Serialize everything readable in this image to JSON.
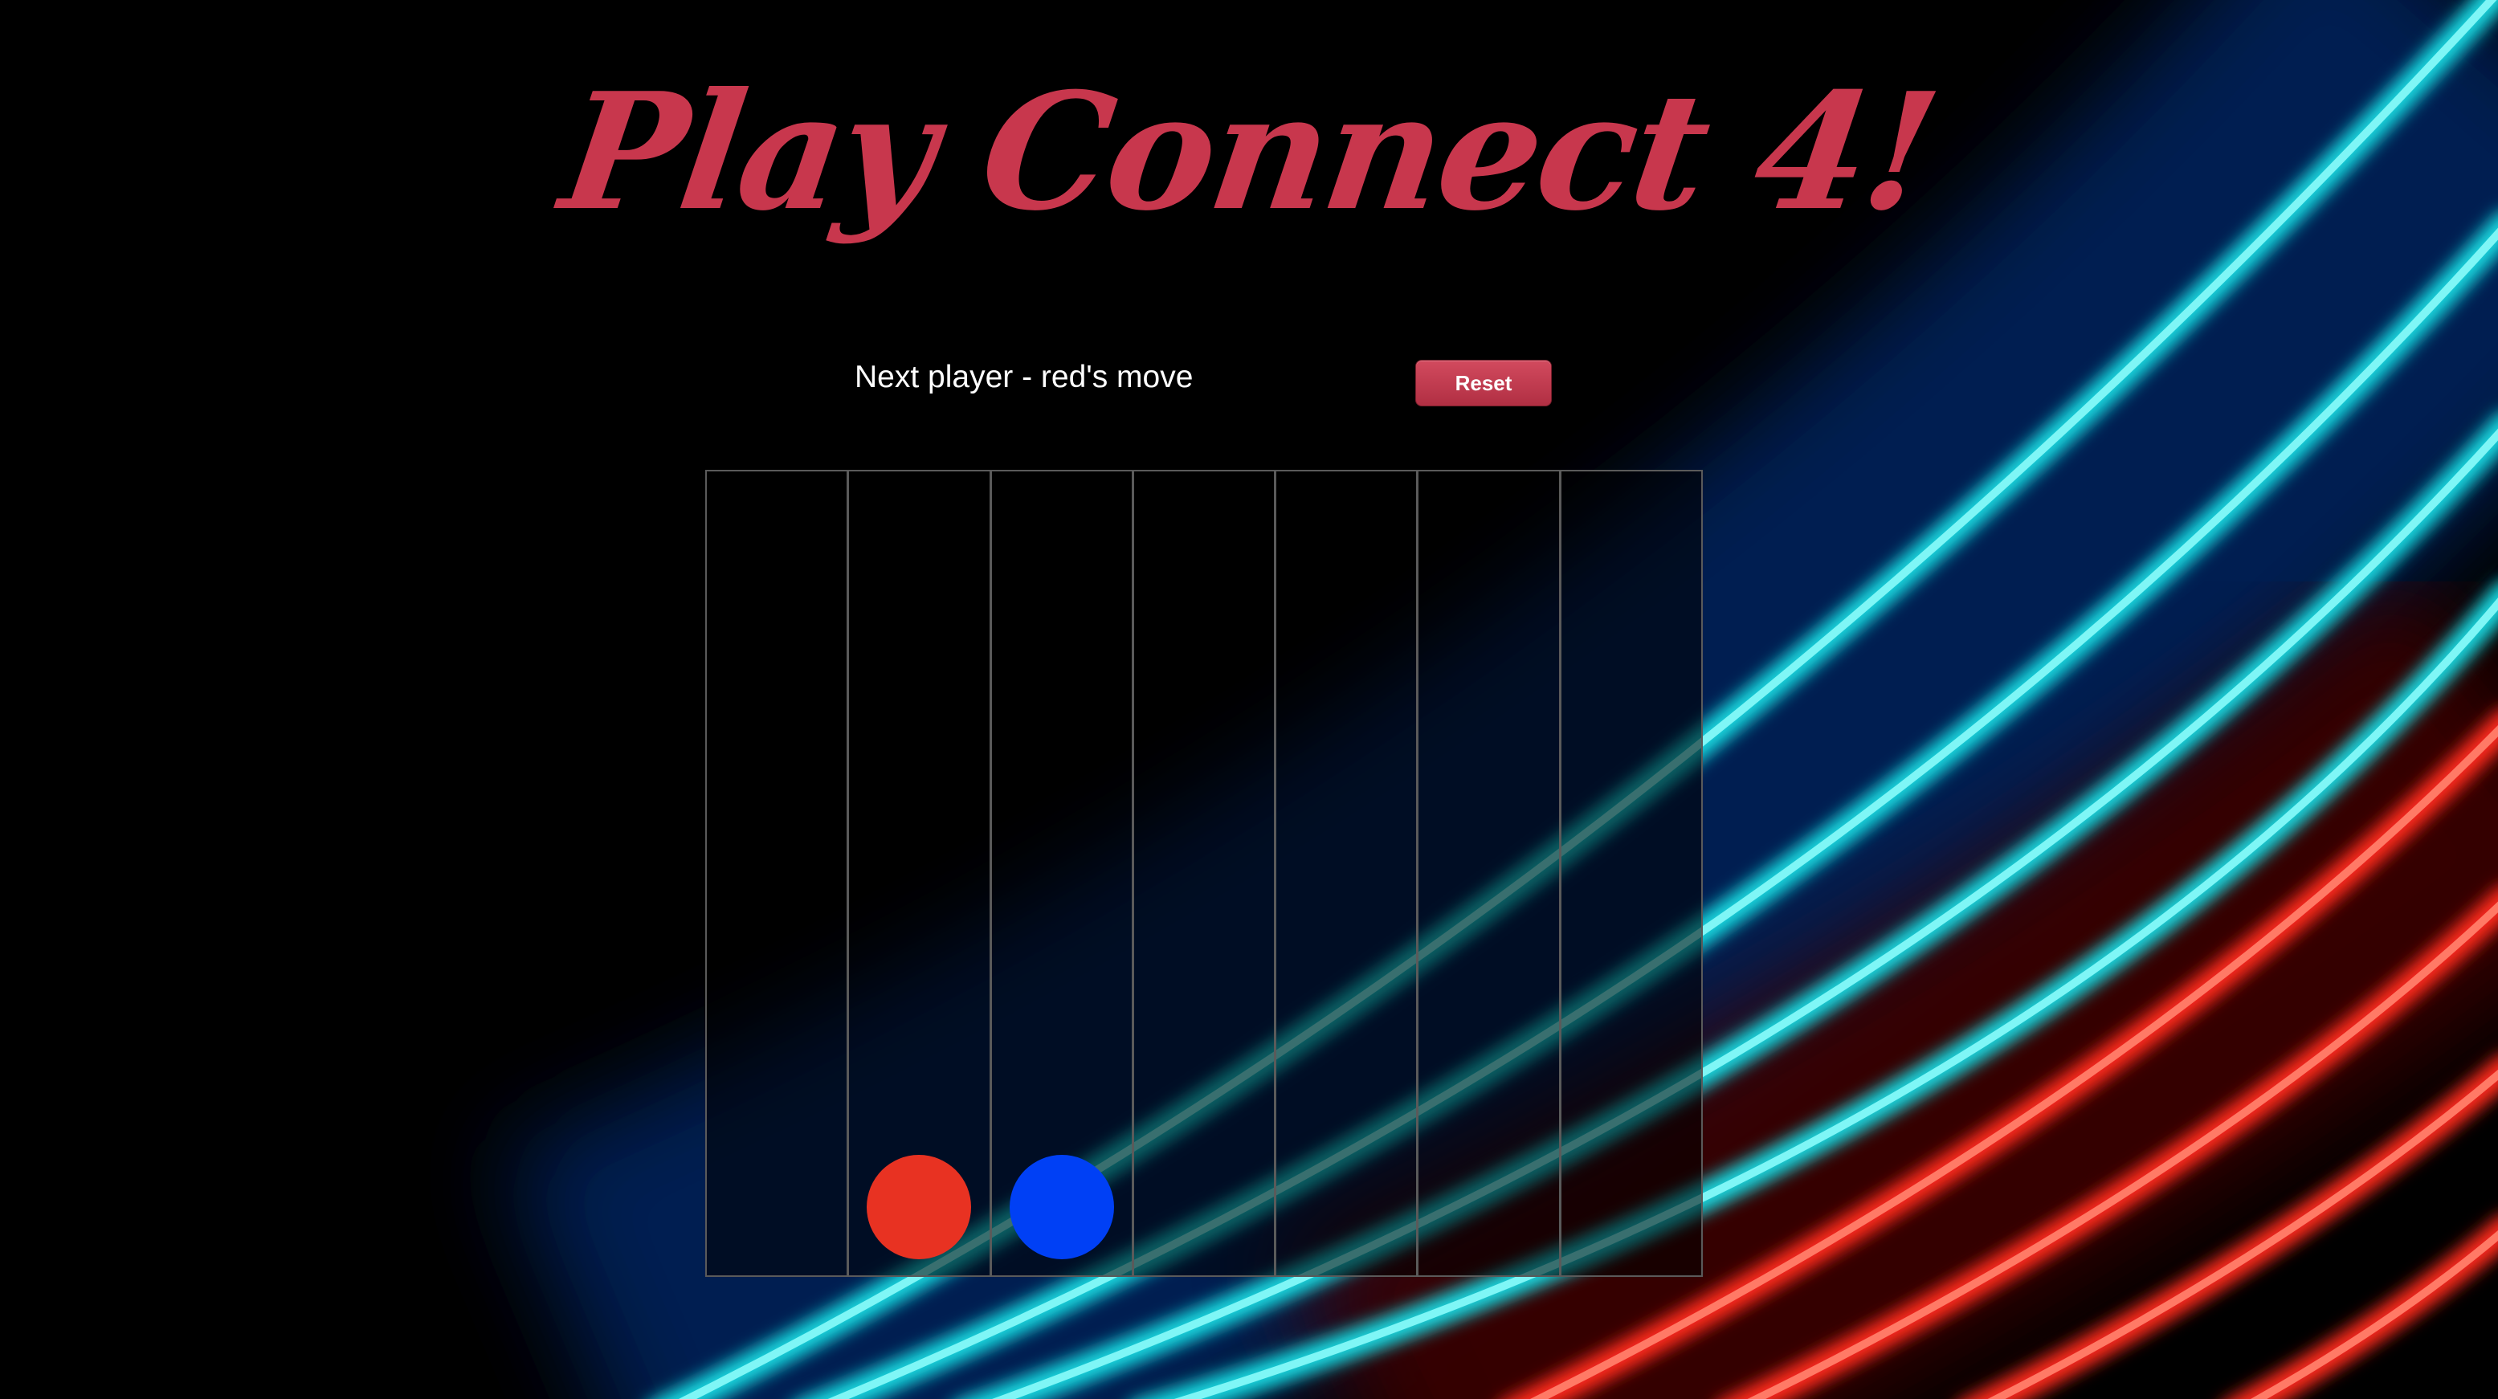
{
  "title": "Play Connect 4!",
  "status_text": "Next player - red's move",
  "reset_label": "Reset",
  "colors": {
    "title": "#c8374d",
    "red_disc": "#e83222",
    "blue_disc": "#0040f5",
    "grid_line": "#5a5a5a",
    "reset_button": "#c23c50"
  },
  "board": {
    "columns": 7,
    "rows": 6,
    "discs": [
      {
        "column": 2,
        "row": 1,
        "color": "red"
      },
      {
        "column": 3,
        "row": 1,
        "color": "blue"
      }
    ]
  }
}
